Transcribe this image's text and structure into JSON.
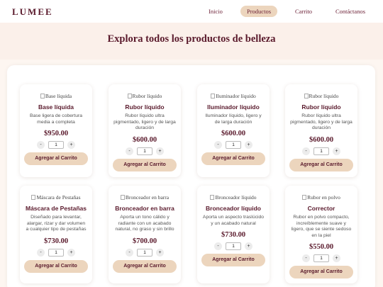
{
  "brand": "LUMEE",
  "nav": [
    "Inicio",
    "Productos",
    "Carrito",
    "Contáctanos"
  ],
  "hero_title": "Explora todos los productos de belleza",
  "qty_minus": "-",
  "qty_plus": "+",
  "products": [
    {
      "img_alt": "Base líquida",
      "name": "Base líquida",
      "desc": "Base ligera de cobertura media a completa",
      "price": "$950.00",
      "qty": "1",
      "button": "Agregar al Carrito"
    },
    {
      "img_alt": "Rubor líquido",
      "name": "Rubor líquido",
      "desc": "Rubor líquido ultra pigmentado, ligero y de larga duración",
      "price": "$600.00",
      "qty": "1",
      "button": "Agregar al Carrito"
    },
    {
      "img_alt": "Iluminador líquido",
      "name": "Iluminador líquido",
      "desc": "Iluminador líquido, ligero y de larga duración",
      "price": "$600.00",
      "qty": "1",
      "button": "Agregar al Carrito"
    },
    {
      "img_alt": "Rubor líquido",
      "name": "Rubor líquido",
      "desc": "Rubor líquido ultra pigmentado, ligero y de larga duración",
      "price": "$600.00",
      "qty": "1",
      "button": "Agregar al Carrito"
    },
    {
      "img_alt": "Máscara de Pestañas",
      "name": "Máscara de Pestañas",
      "desc": "Diseñado para levantar, alargar, rizar y dar volumen a cualquier tipo de pestañas",
      "price": "$730.00",
      "qty": "1",
      "button": "Agregar al Carrito"
    },
    {
      "img_alt": "Bronceador en barra",
      "name": "Bronceador en barra",
      "desc": "Aporta un tono cálido y radiante con un acabado natural, no graso y sin brillo",
      "price": "$700.00",
      "qty": "1",
      "button": "Agregar al Carrito"
    },
    {
      "img_alt": "Bronceador líquido",
      "name": "Bronceador líquido",
      "desc": "Aporta un aspecto traslúcido y un acabado natural",
      "price": "$730.00",
      "qty": "1",
      "button": "Agregar al Carrito"
    },
    {
      "img_alt": "Rubor en polvo",
      "name": "Corrector",
      "desc": "Rubor en polvo compacto, increíblemente suave y ligero, que se siente sedoso en la piel",
      "price": "$550.00",
      "qty": "1",
      "button": "Agregar al Carrito"
    }
  ]
}
